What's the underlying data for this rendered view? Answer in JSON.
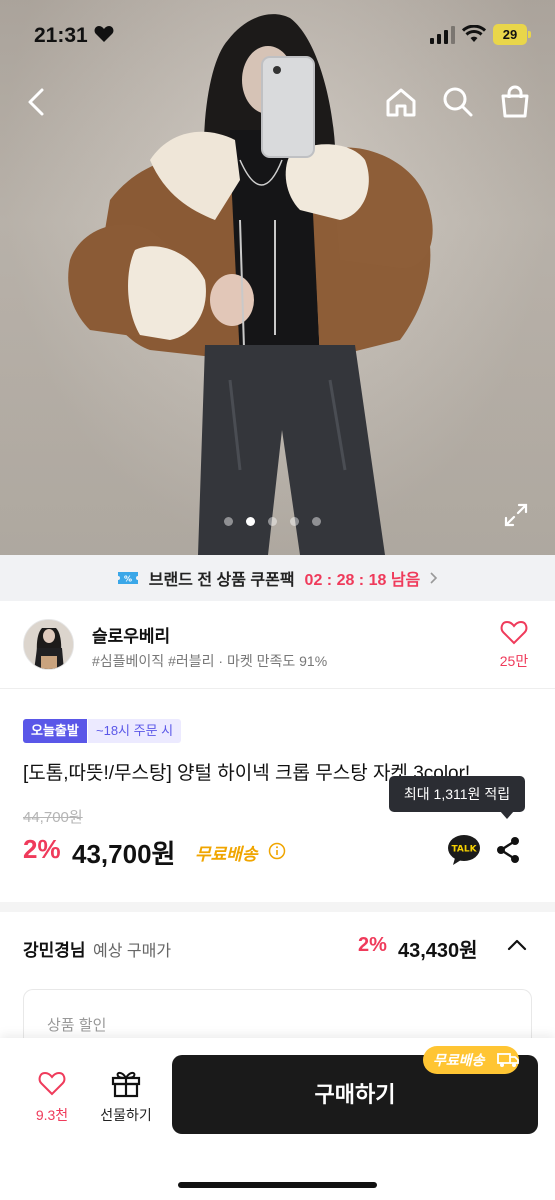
{
  "status_bar": {
    "time": "21:31",
    "battery": "29",
    "icons": [
      "heart-icon",
      "signal-icon",
      "wifi-icon",
      "battery-charging-icon"
    ]
  },
  "nav": {
    "icons": [
      "back-arrow-icon",
      "home-icon",
      "search-icon",
      "shopping-bag-icon"
    ]
  },
  "gallery": {
    "image_count": 5,
    "active_index": 1,
    "icons": [
      "expand-icon"
    ]
  },
  "coupon_banner": {
    "text": "브랜드 전 상품 쿠폰팩",
    "timer": "02 : 28 : 18 남음",
    "icons": [
      "coupon-ticket-icon",
      "chevron-right-icon"
    ]
  },
  "shop": {
    "name": "슬로우베리",
    "tags": "#심플베이직 #러블리 · 마켓 만족도 91%",
    "like_count": "25만"
  },
  "product": {
    "badge_today": "오늘출발",
    "badge_time": "~18시 주문 시",
    "title": "[도톰,따뜻!/무스탕] 양털 하이넥 크롭 무스탕 자켓 3color!",
    "tooltip": "최대 1,311원 적립",
    "original_price": "44,700원",
    "discount_rate": "2%",
    "price": "43,700원",
    "shipping": "무료배송",
    "talk_label": "TALK"
  },
  "expected": {
    "name": "강민경님",
    "label": "예상 구매가",
    "discount_rate": "2%",
    "price": "43,430원",
    "section_label": "상품 할인"
  },
  "bottom_bar": {
    "like_count": "9.3천",
    "gift_label": "선물하기",
    "buy_label": "구매하기",
    "shipping_pill": "무료배송"
  },
  "colors": {
    "accent_red": "#ef3b5b",
    "badge_purple": "#5a57e8",
    "shipping_yellow": "#ffc533",
    "buy_button": "#1a1a1a"
  }
}
